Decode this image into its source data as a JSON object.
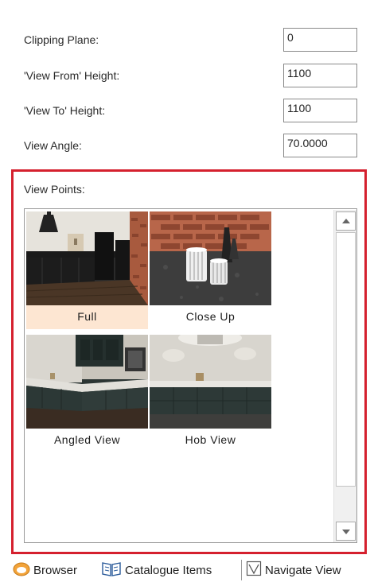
{
  "fields": {
    "clipping_plane": {
      "label": "Clipping Plane:",
      "value": "0"
    },
    "view_from_height": {
      "label": "'View From' Height:",
      "value": "1100"
    },
    "view_to_height": {
      "label": "'View To' Height:",
      "value": "1100"
    },
    "view_angle": {
      "label": "View Angle:",
      "value": "70.0000"
    }
  },
  "viewpoints": {
    "label": "View Points:",
    "items": [
      {
        "label": "Full",
        "selected": true,
        "thumbnail": "kitchen-full-view"
      },
      {
        "label": "Close Up",
        "selected": false,
        "thumbnail": "kitchen-close-up"
      },
      {
        "label": "Angled View",
        "selected": false,
        "thumbnail": "kitchen-angled-view"
      },
      {
        "label": "Hob View",
        "selected": false,
        "thumbnail": "kitchen-hob-view"
      }
    ]
  },
  "bottom_tabs": [
    {
      "label": "Browser",
      "icon": "browser-icon"
    },
    {
      "label": "Catalogue Items",
      "icon": "catalogue-book-icon"
    },
    {
      "label": "Navigate View",
      "icon": "navigate-view-icon"
    }
  ],
  "colors": {
    "highlight_border": "#d5202e",
    "selected_item_background": "#fde6d2"
  }
}
